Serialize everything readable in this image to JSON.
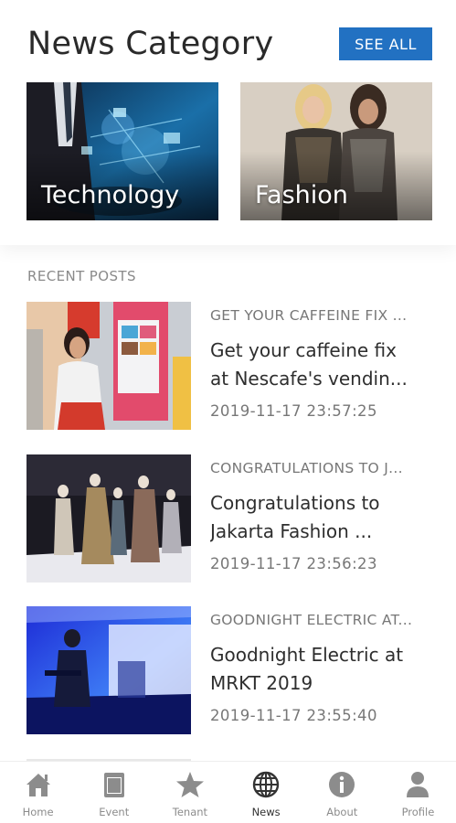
{
  "header": {
    "title": "News Category",
    "see_all_label": "SEE ALL"
  },
  "categories": [
    {
      "label": "Technology",
      "image": "technology-photo"
    },
    {
      "label": "Fashion",
      "image": "fashion-photo"
    }
  ],
  "recent": {
    "section_label": "RECENT POSTS",
    "posts": [
      {
        "kicker": "GET YOUR CAFFEINE FIX ...",
        "title_line1": "Get your caffeine fix",
        "title_line2": "at Nescafe's vendin...",
        "date": "2019-11-17 23:57:25",
        "image": "vending-machine-photo"
      },
      {
        "kicker": "CONGRATULATIONS TO J...",
        "title_line1": "Congratulations to",
        "title_line2": "Jakarta Fashion ...",
        "date": "2019-11-17 23:56:23",
        "image": "runway-photo"
      },
      {
        "kicker": "GOODNIGHT ELECTRIC AT...",
        "title_line1": "Goodnight Electric at",
        "title_line2": "MRKT 2019",
        "date": "2019-11-17 23:55:40",
        "image": "concert-photo"
      }
    ]
  },
  "tabbar": {
    "active": "News",
    "items": [
      {
        "label": "Home",
        "icon": "home-icon"
      },
      {
        "label": "Event",
        "icon": "event-icon"
      },
      {
        "label": "Tenant",
        "icon": "star-icon"
      },
      {
        "label": "News",
        "icon": "globe-icon"
      },
      {
        "label": "About",
        "icon": "info-icon"
      },
      {
        "label": "Profile",
        "icon": "person-icon"
      }
    ]
  },
  "colors": {
    "accent": "#2271c2",
    "muted_text": "#777777",
    "icon_gray": "#8c8c8c",
    "icon_active": "#333333"
  }
}
